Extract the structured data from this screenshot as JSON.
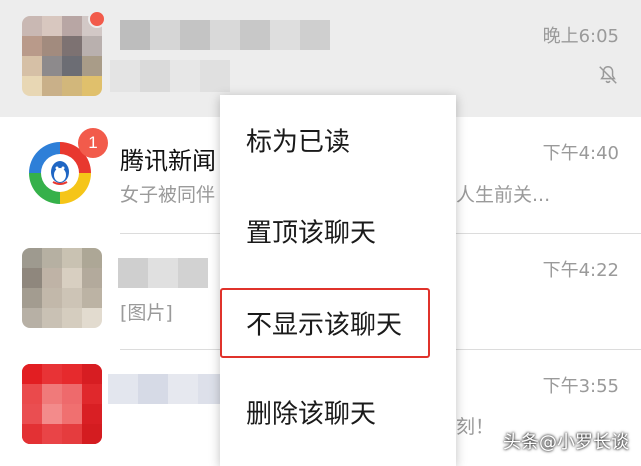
{
  "chats": [
    {
      "name": "",
      "preview": "",
      "time": "晚上6:05",
      "muted": true,
      "unread_dot": true
    },
    {
      "name": "腾讯新闻",
      "preview": "女子被同伴",
      "preview_tail": "人生前关...",
      "time": "下午4:40",
      "badge": "1"
    },
    {
      "name": "",
      "preview": "[图片]",
      "time": "下午4:22"
    },
    {
      "name": "",
      "preview": "",
      "preview_tail": "刻！",
      "time": "下午3:55"
    }
  ],
  "context_menu": {
    "items": [
      {
        "label": "标为已读"
      },
      {
        "label": "置顶该聊天"
      },
      {
        "label": "不显示该聊天"
      },
      {
        "label": "删除该聊天"
      }
    ]
  },
  "watermark": "头条@小罗长谈",
  "colors": {
    "badge": "#f25b4b",
    "highlight_box": "#e0322b",
    "selected_row": "#ededed"
  },
  "icons": {
    "mute": "bell-off-icon",
    "qq": "tencent-news-logo"
  }
}
